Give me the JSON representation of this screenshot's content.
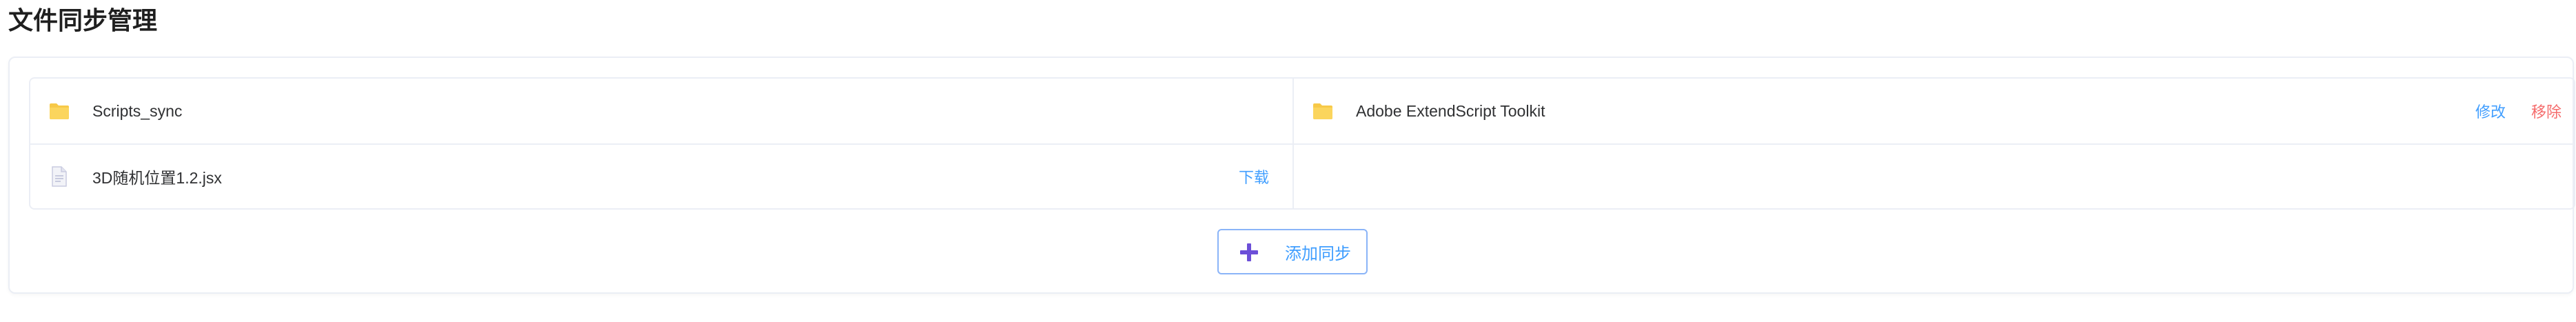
{
  "page": {
    "title": "文件同步管理"
  },
  "files": [
    {
      "type": "folder",
      "name": "Scripts_sync",
      "icon": "folder-icon"
    },
    {
      "type": "folder",
      "name": "Adobe ExtendScript Toolkit",
      "icon": "folder-icon",
      "actions": {
        "edit": "修改",
        "remove": "移除"
      }
    },
    {
      "type": "file",
      "name": "3D随机位置1.2.jsx",
      "icon": "file-icon",
      "actions": {
        "download": "下载"
      }
    }
  ],
  "add_button": {
    "label": "添加同步",
    "icon": "plus-icon"
  },
  "colors": {
    "folder": "#f7c948",
    "link_blue": "#409eff",
    "danger_red": "#f56c6c",
    "plus_purple": "#6c4fd8",
    "border": "#ebeef5"
  }
}
